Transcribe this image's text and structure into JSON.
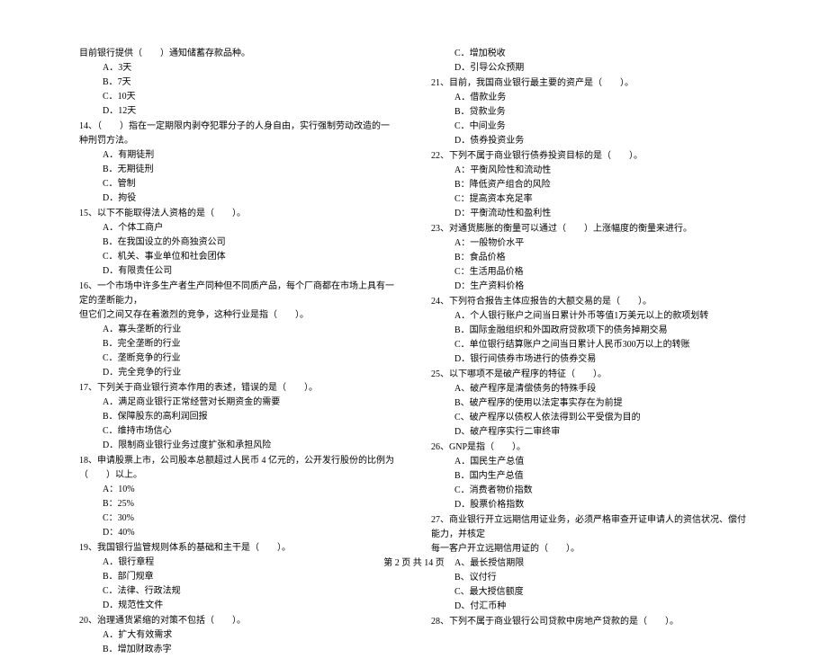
{
  "left": {
    "preQuestion": {
      "text": "目前银行提供（　　）通知储蓄存款品种。",
      "options": [
        "A．3天",
        "B．7天",
        "C．10天",
        "D．12天"
      ]
    },
    "q14": {
      "text": "14、（　　）指在一定期限内剥夺犯罪分子的人身自由，实行强制劳动改造的一种刑罚方法。",
      "options": [
        "A．有期徒刑",
        "B．无期徒刑",
        "C．管制",
        "D．拘役"
      ]
    },
    "q15": {
      "text": "15、以下不能取得法人资格的是（　　）。",
      "options": [
        "A．个体工商户",
        "B．在我国设立的外商独资公司",
        "C．机关、事业单位和社会团体",
        "D．有限责任公司"
      ]
    },
    "q16": {
      "text1": "16、一个市场中许多生产者生产同种但不同质产品，每个厂商都在市场上具有一定的垄断能力，",
      "text2": "但它们之间又存在着激烈的竞争，这种行业是指（　　）。",
      "options": [
        "A．寡头垄断的行业",
        "B．完全垄断的行业",
        "C．垄断竞争的行业",
        "D．完全竞争的行业"
      ]
    },
    "q17": {
      "text": "17、下列关于商业银行资本作用的表述，错误的是（　　）。",
      "options": [
        "A．满足商业银行正常经营对长期资金的需要",
        "B．保障股东的高利润回报",
        "C．维持市场信心",
        "D．限制商业银行业务过度扩张和承担风险"
      ]
    },
    "q18": {
      "text": "18、申请股票上市，公司股本总额超过人民币 4 亿元的，公开发行股份的比例为（　　）以上。",
      "options": [
        "A：10%",
        "B：25%",
        "C：30%",
        "D：40%"
      ]
    },
    "q19": {
      "text": "19、我国银行监管规则体系的基础和主干是（　　）。",
      "options": [
        "A．银行章程",
        "B．部门规章",
        "C．法律、行政法规",
        "D．规范性文件"
      ]
    },
    "q20": {
      "text": "20、治理通货紧缩的对策不包括（　　）。",
      "options": [
        "A．扩大有效需求",
        "B．增加财政赤字"
      ]
    }
  },
  "right": {
    "preOptions": [
      "C．增加税收",
      "D．引导公众预期"
    ],
    "q21": {
      "text": "21、目前，我国商业银行最主要的资产是（　　）。",
      "options": [
        "A．借款业务",
        "B．贷款业务",
        "C．中间业务",
        "D．债券投资业务"
      ]
    },
    "q22": {
      "text": "22、下列不属于商业银行债券投资目标的是（　　）。",
      "options": [
        "A：平衡风险性和流动性",
        "B：降低资产组合的风险",
        "C：提高资本充足率",
        "D：平衡流动性和盈利性"
      ]
    },
    "q23": {
      "text": "23、对通货膨胀的衡量可以通过（　　）上涨幅度的衡量来进行。",
      "options": [
        "A：一般物价水平",
        "B：食品价格",
        "C：生活用品价格",
        "D：生产资料价格"
      ]
    },
    "q24": {
      "text": "24、下列符合报告主体应报告的大额交易的是（　　）。",
      "options": [
        "A．个人银行账户之间当日累计外币等值1万美元以上的款项划转",
        "B．国际金融组织和外国政府贷款项下的债务掉期交易",
        "C．单位银行结算账户之间当日累计人民币300万以上的转账",
        "D．银行间债券市场进行的债券交易"
      ]
    },
    "q25": {
      "text": "25、以下哪项不是破产程序的特征（　　）。",
      "options": [
        "A、破产程序是清偿债务的特殊手段",
        "B、破产程序的使用以法定事实存在为前提",
        "C、破产程序以债权人依法得到公平受偿为目的",
        "D、破产程序实行二审终审"
      ]
    },
    "q26": {
      "text": "26、GNP是指（　　）。",
      "options": [
        "A．国民生产总值",
        "B．国内生产总值",
        "C．消费者物价指数",
        "D．股票价格指数"
      ]
    },
    "q27": {
      "text1": "27、商业银行开立远期信用证业务，必须严格审查开证申请人的资信状况、偿付能力，并核定",
      "text2": "每一客户开立远期信用证的（　　）。",
      "options": [
        "A、最长授信期限",
        "B、议付行",
        "C、最大授信额度",
        "D、付汇币种"
      ]
    },
    "q28": {
      "text": "28、下列不属于商业银行公司贷款中房地产贷款的是（　　）。"
    }
  },
  "footer": "第 2 页 共 14 页"
}
